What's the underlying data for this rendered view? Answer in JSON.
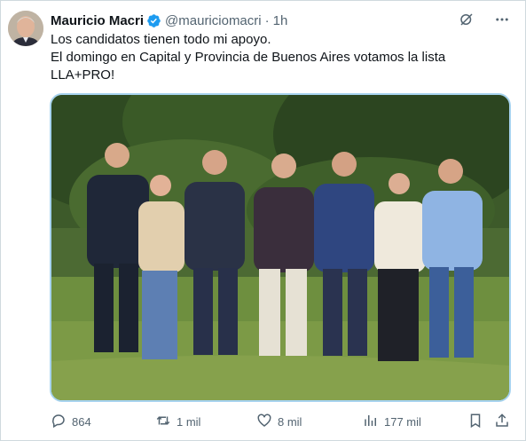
{
  "author": {
    "name": "Mauricio Macri",
    "handle": "@mauriciomacri",
    "separator": "·",
    "time": "1h"
  },
  "tweet": {
    "lines": [
      "Los candidatos tienen todo mi apoyo.",
      "El domingo en Capital y Provincia de Buenos Aires votamos la lista",
      "LLA+PRO!"
    ]
  },
  "actions": {
    "replies": "864",
    "retweets": "1 mil",
    "likes": "8 mil",
    "views": "177 mil"
  },
  "colors": {
    "verified": "#1d9bf0",
    "text_secondary": "#536471",
    "media_border": "#a7d3ef"
  },
  "icons": [
    "grok-icon",
    "more-icon",
    "reply-icon",
    "retweet-icon",
    "like-icon",
    "views-icon",
    "bookmark-icon",
    "share-icon"
  ]
}
